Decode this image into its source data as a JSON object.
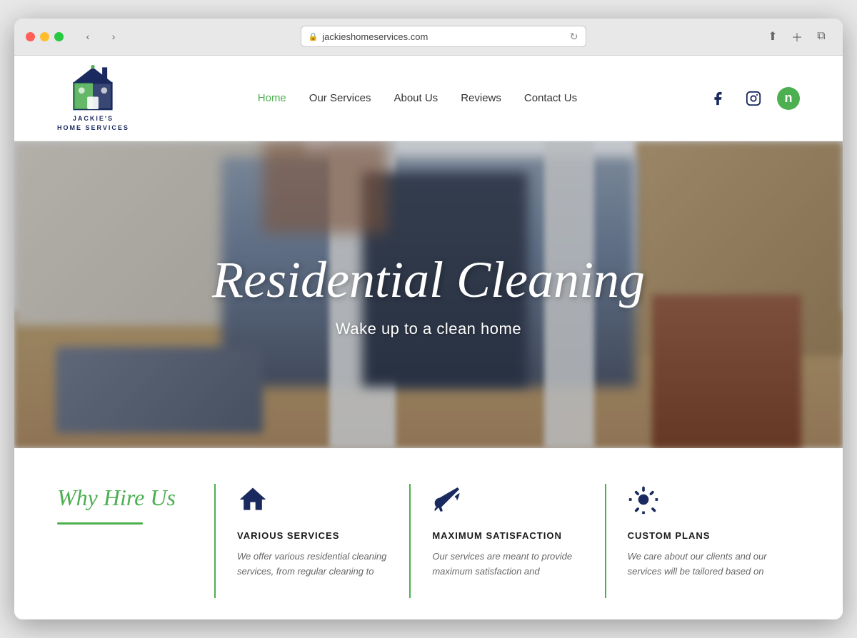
{
  "browser": {
    "url": "jackieshomeservices.com",
    "refresh_icon": "↻"
  },
  "header": {
    "logo_name": "JACKIE'S",
    "logo_subtext": "HOME SERVICES",
    "nav": [
      {
        "label": "Home",
        "active": true
      },
      {
        "label": "Our Services",
        "active": false
      },
      {
        "label": "About Us",
        "active": false
      },
      {
        "label": "Reviews",
        "active": false
      },
      {
        "label": "Contact Us",
        "active": false
      }
    ],
    "social": [
      {
        "name": "facebook",
        "icon": "f"
      },
      {
        "name": "instagram",
        "icon": "📷"
      },
      {
        "name": "nextdoor",
        "icon": "n"
      }
    ]
  },
  "hero": {
    "title": "Residential Cleaning",
    "subtitle": "Wake up to a clean home"
  },
  "why_section": {
    "heading_line1": "Why Hire Us",
    "services": [
      {
        "icon": "house",
        "title": "VARIOUS SERVICES",
        "description": "We offer various residential cleaning services, from regular cleaning to"
      },
      {
        "icon": "broom",
        "title": "MAXIMUM SATISFACTION",
        "description": "Our services are meant to provide maximum satisfaction and"
      },
      {
        "icon": "hand-sparkles",
        "title": "CUSTOM PLANS",
        "description": "We care about our clients and our services will be tailored based on"
      }
    ]
  }
}
